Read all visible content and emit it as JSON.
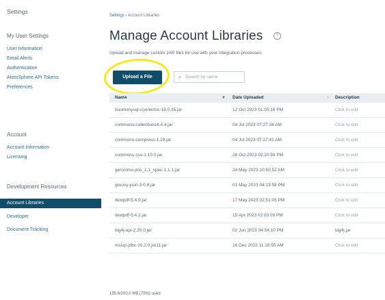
{
  "sidebar": {
    "settings_heading": "Settings",
    "user_settings_heading": "My User Settings",
    "user_items": [
      "User Information",
      "Email Alerts",
      "Authentication",
      "AtomSphere API Tokens",
      "Preferences"
    ],
    "account_heading": "Account",
    "account_items": [
      "Account Information",
      "Licensing"
    ],
    "dev_heading": "Development Resources",
    "dev_items": [
      "Account Libraries",
      "Developer",
      "Document Tracking"
    ],
    "active_item": "Account Libraries"
  },
  "breadcrumb": {
    "root": "Settings",
    "separator": "›",
    "current": "Account Libraries"
  },
  "page": {
    "title": "Manage Account Libraries",
    "help_icon": "?",
    "description": "Upload and manage custom JAR files for use with your integration processes."
  },
  "toolbar": {
    "upload_label": "Upload a File",
    "search_placeholder": "Search by name",
    "search_value": ""
  },
  "table": {
    "columns": [
      "Name",
      "Date Uploaded",
      "Description"
    ],
    "sort_indicator": "▼",
    "sort_indicator_date": "↕",
    "rows": [
      {
        "name": "boomimysql-connector-18.0.35.jar",
        "date": "12 Oct 2023 01:05:16 PM",
        "desc": "Click to edit"
      },
      {
        "name": "commons-collections4-4.4.jar",
        "date": "04 Jul 2023 07:27:34 AM",
        "desc": "Click to edit"
      },
      {
        "name": "commons-compress-1.19.jar",
        "date": "04 Jul 2023 07:27:41 AM",
        "desc": "Click to edit"
      },
      {
        "name": "commons-csv-1.10.0.jar",
        "date": "26 Oct 2023 02:20:59 PM",
        "desc": "Click to edit"
      },
      {
        "name": "geronimo-jms_1.1_spec-1.1.1.jar",
        "date": "24 May 2023 10:50:52 AM",
        "desc": "Click to edit"
      },
      {
        "name": "groovy-json-3.0.8.jar",
        "date": "01 May 2023 04:23:58 PM",
        "desc": "Click to edit"
      },
      {
        "name": "itextpdf-5.4.0.jar",
        "date": "17 May 2023 02:51:05 PM",
        "desc": "Click to edit"
      },
      {
        "name": "itextpdf-5.4.2.jar",
        "date": "15 Apr 2023 02:03:09 PM",
        "desc": "Click to edit"
      },
      {
        "name": "log4j-api-2.20.0.jar",
        "date": "02 Jun 2023 04:54:10 PM",
        "desc": "log4j.jar"
      },
      {
        "name": "mssql-jdbc-10.2.0.jre11.jar",
        "date": "16 Dec 2022 11:18:55 AM",
        "desc": "Click to edit"
      }
    ]
  },
  "footer": {
    "usage": "155.6/200.0 MB (78%) used"
  },
  "colors": {
    "accent": "#0f4d68",
    "link": "#2d6f8f",
    "highlight": "#f3ea1c"
  }
}
